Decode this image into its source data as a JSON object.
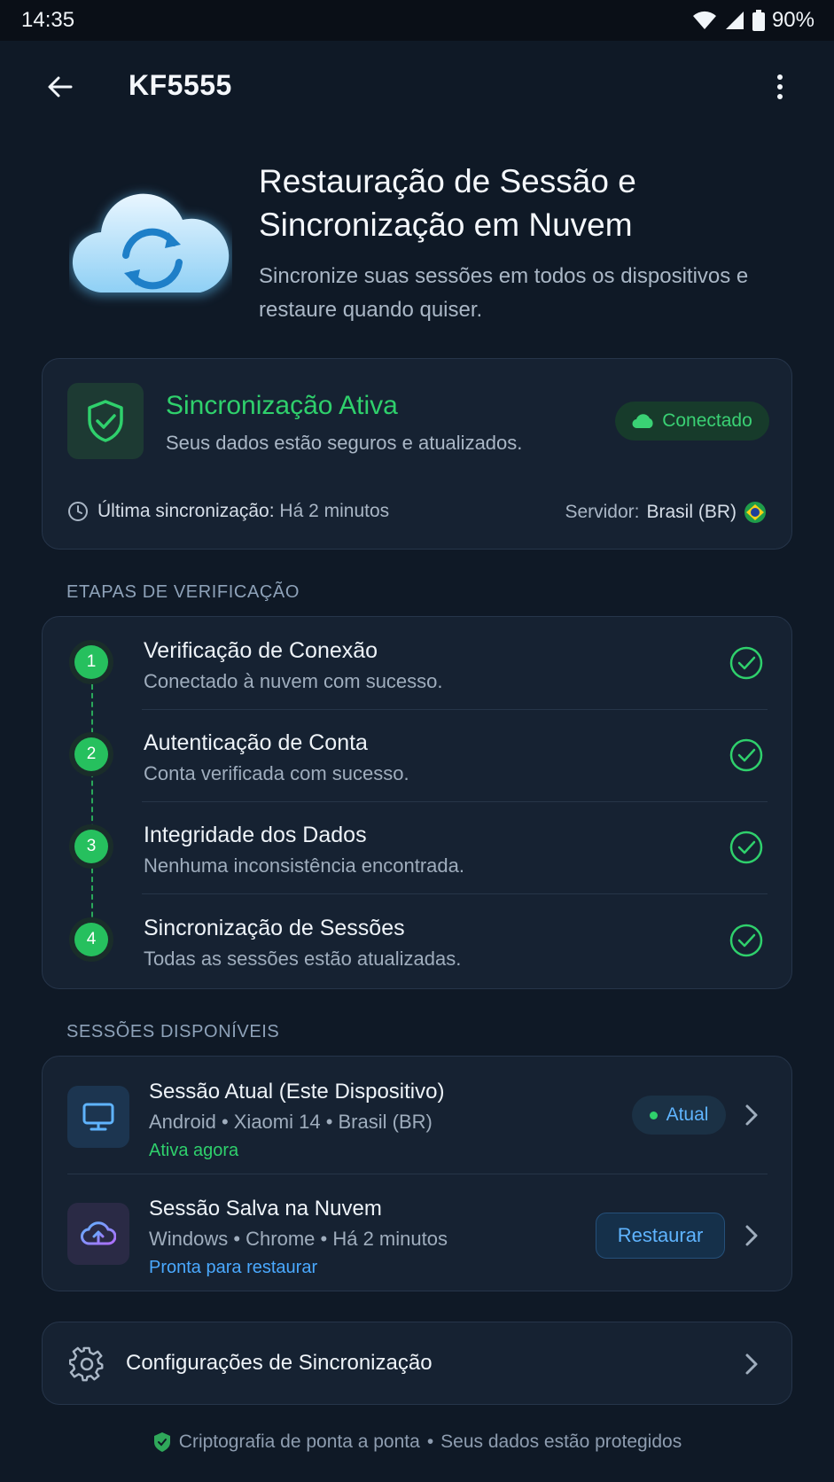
{
  "status_bar": {
    "time": "14:35",
    "battery": "90%"
  },
  "app_bar": {
    "title": "KF5555"
  },
  "hero": {
    "title": "Restauração de Sessão e Sincronização em Nuvem",
    "subtitle": "Sincronize suas sessões em todos os dispositivos e restaure quando quiser."
  },
  "sync_status": {
    "title": "Sincronização Ativa",
    "description": "Seus dados estão seguros e atualizados.",
    "badge": "Conectado",
    "last_sync_label": "Última sincronização:",
    "last_sync_value": "Há 2 minutos",
    "server_label": "Servidor:",
    "server_value": "Brasil (BR)"
  },
  "steps_section": {
    "label": "ETAPAS DE VERIFICAÇÃO",
    "steps": [
      {
        "num": "1",
        "title": "Verificação de Conexão",
        "desc": "Conectado à nuvem com sucesso."
      },
      {
        "num": "2",
        "title": "Autenticação de Conta",
        "desc": "Conta verificada com sucesso."
      },
      {
        "num": "3",
        "title": "Integridade dos Dados",
        "desc": "Nenhuma inconsistência encontrada."
      },
      {
        "num": "4",
        "title": "Sincronização de Sessões",
        "desc": "Todas as sessões estão atualizadas."
      }
    ]
  },
  "sessions_section": {
    "label": "SESSÕES DISPONÍVEIS",
    "sessions": [
      {
        "title": "Sessão Atual (Este Dispositivo)",
        "meta": "Android • Xiaomi 14 • Brasil (BR)",
        "state": "Ativa agora",
        "badge": "Atual"
      },
      {
        "title": "Sessão Salva na Nuvem",
        "meta": "Windows • Chrome • Há 2 minutos",
        "state": "Pronta para restaurar",
        "button": "Restaurar"
      }
    ]
  },
  "settings": {
    "label": "Configurações de Sincronização"
  },
  "footer": {
    "left": "Criptografia de ponta a ponta",
    "separator": "•",
    "right": "Seus dados estão protegidos"
  },
  "colors": {
    "background": "#0f1926",
    "card": "#162232",
    "success": "#2fd06c",
    "accent": "#5fb4ff"
  },
  "icons": [
    "back-arrow-icon",
    "more-vert-icon",
    "cloud-sync-icon",
    "shield-check-icon",
    "cloud-icon",
    "clock-icon",
    "brazil-flag-icon",
    "check-circle-icon",
    "monitor-icon",
    "cloud-upload-icon",
    "chevron-right-icon",
    "gear-icon",
    "shield-icon"
  ]
}
